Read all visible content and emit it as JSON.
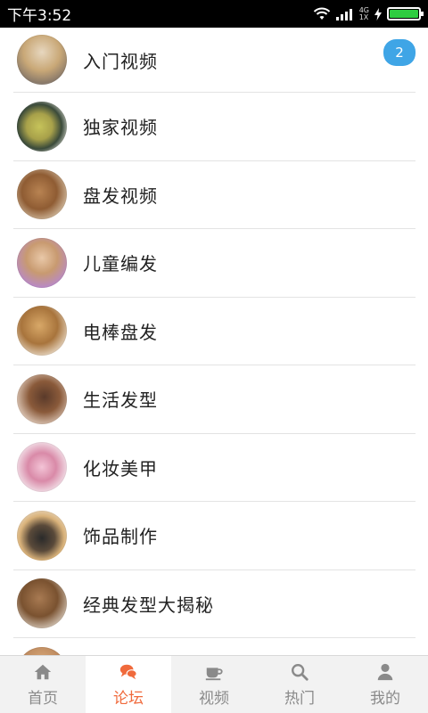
{
  "status_bar": {
    "time": "下午3:52",
    "network_top": "4G",
    "network_bottom": "1X"
  },
  "forum": {
    "items": [
      {
        "label": "入门视频",
        "badge": "2"
      },
      {
        "label": "独家视频"
      },
      {
        "label": "盘发视频"
      },
      {
        "label": "儿童编发"
      },
      {
        "label": "电棒盘发"
      },
      {
        "label": "生活发型"
      },
      {
        "label": "化妆美甲"
      },
      {
        "label": "饰品制作"
      },
      {
        "label": "经典发型大揭秘"
      }
    ]
  },
  "tabs": [
    {
      "label": "首页",
      "icon": "home-icon"
    },
    {
      "label": "论坛",
      "icon": "chat-icon",
      "active": true
    },
    {
      "label": "视频",
      "icon": "cup-icon"
    },
    {
      "label": "热门",
      "icon": "search-icon"
    },
    {
      "label": "我的",
      "icon": "user-icon"
    }
  ],
  "colors": {
    "accent": "#f06a3c",
    "badge": "#3fa5e6",
    "tab_inactive": "#8a8a8a"
  }
}
